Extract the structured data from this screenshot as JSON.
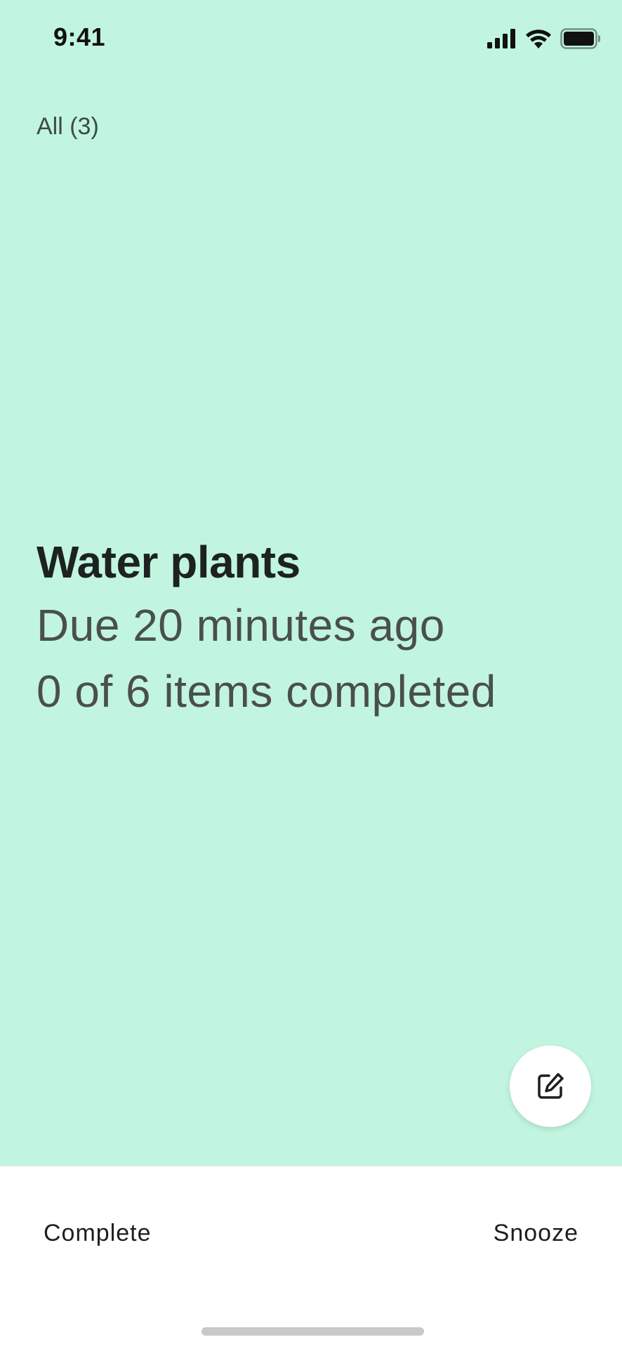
{
  "status_bar": {
    "time": "9:41",
    "icons": [
      "cellular-signal-icon",
      "wifi-icon",
      "battery-icon"
    ]
  },
  "filter": {
    "label": "All (3)"
  },
  "task": {
    "title": "Water plants",
    "due": "Due 20 minutes ago",
    "progress": "0 of 6 items completed"
  },
  "actions": {
    "edit_icon": "edit-icon",
    "complete_label": "Complete",
    "snooze_label": "Snooze"
  },
  "colors": {
    "main_background": "#c1f5df",
    "bottom_background": "#ffffff",
    "title_text": "#1d2220",
    "secondary_text": "#4a4f4d"
  }
}
